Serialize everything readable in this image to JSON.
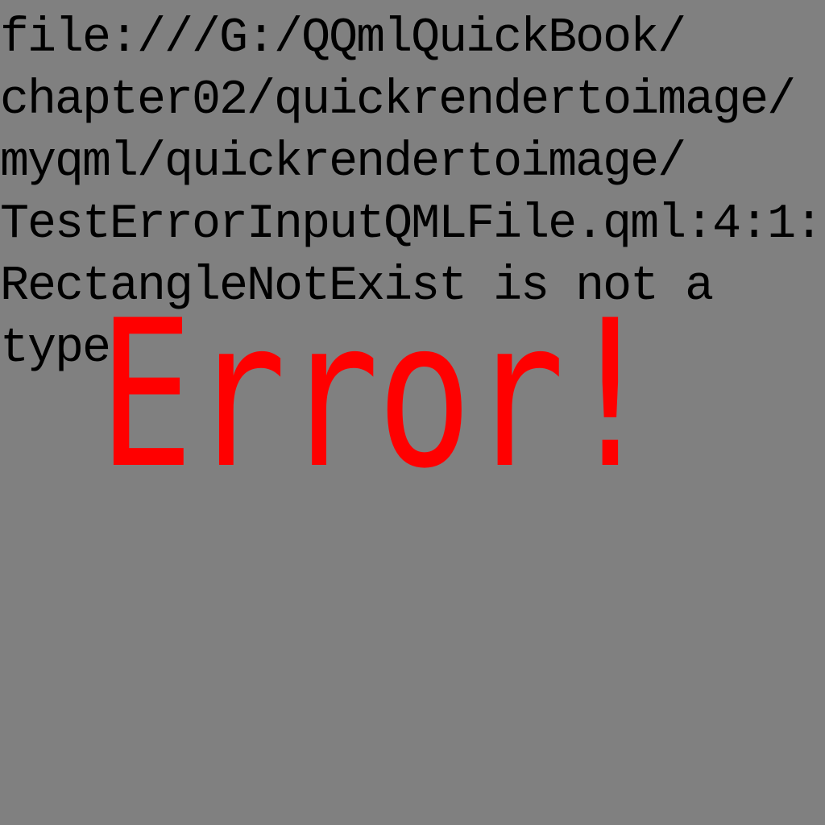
{
  "colors": {
    "background": "#808080",
    "message_text": "#000000",
    "error_title": "#ff0000"
  },
  "error": {
    "message_lines": [
      "file:///G:/QQmlQuickBook/",
      "chapter02/quickrendertoimage/",
      "myqml/quickrendertoimage/",
      "TestErrorInputQMLFile.qml:4:1:",
      "RectangleNotExist is not a",
      "type"
    ],
    "title": "Error!"
  }
}
